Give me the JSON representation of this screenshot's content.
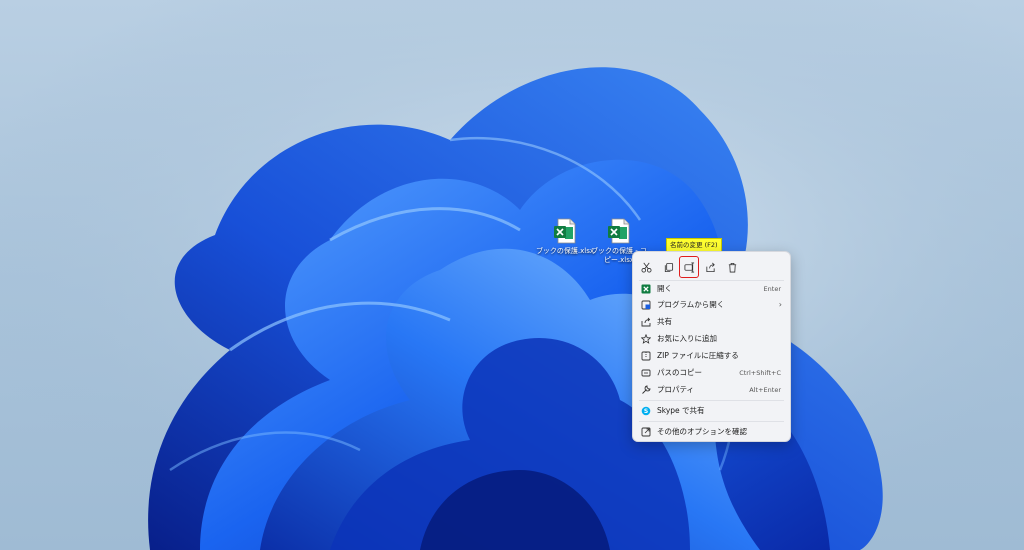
{
  "desktop": {
    "icons": [
      {
        "label": "ブックの保護.xlsx",
        "icon": "excel-file-icon"
      },
      {
        "label": "ブックの保護 - コピー.xlsx",
        "icon": "excel-file-icon"
      }
    ]
  },
  "tooltip": {
    "text": "名前の変更 (F2)"
  },
  "context_menu": {
    "toolbar": [
      {
        "name": "cut",
        "icon": "scissors-icon"
      },
      {
        "name": "copy",
        "icon": "copy-icon"
      },
      {
        "name": "rename",
        "icon": "rename-icon",
        "selected": true
      },
      {
        "name": "share",
        "icon": "share-icon"
      },
      {
        "name": "delete",
        "icon": "trash-icon"
      }
    ],
    "items": [
      {
        "label": "開く",
        "shortcut": "Enter",
        "icon": "excel-icon"
      },
      {
        "label": "プログラムから開く",
        "shortcut": "",
        "icon": "open-with-icon",
        "submenu": true
      },
      {
        "label": "共有",
        "shortcut": "",
        "icon": "share-icon"
      },
      {
        "label": "お気に入りに追加",
        "shortcut": "",
        "icon": "star-icon"
      },
      {
        "label": "ZIP ファイルに圧縮する",
        "shortcut": "",
        "icon": "zip-icon"
      },
      {
        "label": "パスのコピー",
        "shortcut": "Ctrl+Shift+C",
        "icon": "path-copy-icon"
      },
      {
        "label": "プロパティ",
        "shortcut": "Alt+Enter",
        "icon": "wrench-icon"
      },
      {
        "label": "Skype で共有",
        "shortcut": "",
        "icon": "skype-icon"
      },
      {
        "label": "その他のオプションを確認",
        "shortcut": "",
        "icon": "more-options-icon"
      }
    ],
    "submenu_arrow": "›"
  },
  "colors": {
    "accent": "#1a5fe0",
    "excel": "#1d7a44",
    "highlight": "#e01e1e",
    "tooltip": "#ffff30"
  }
}
